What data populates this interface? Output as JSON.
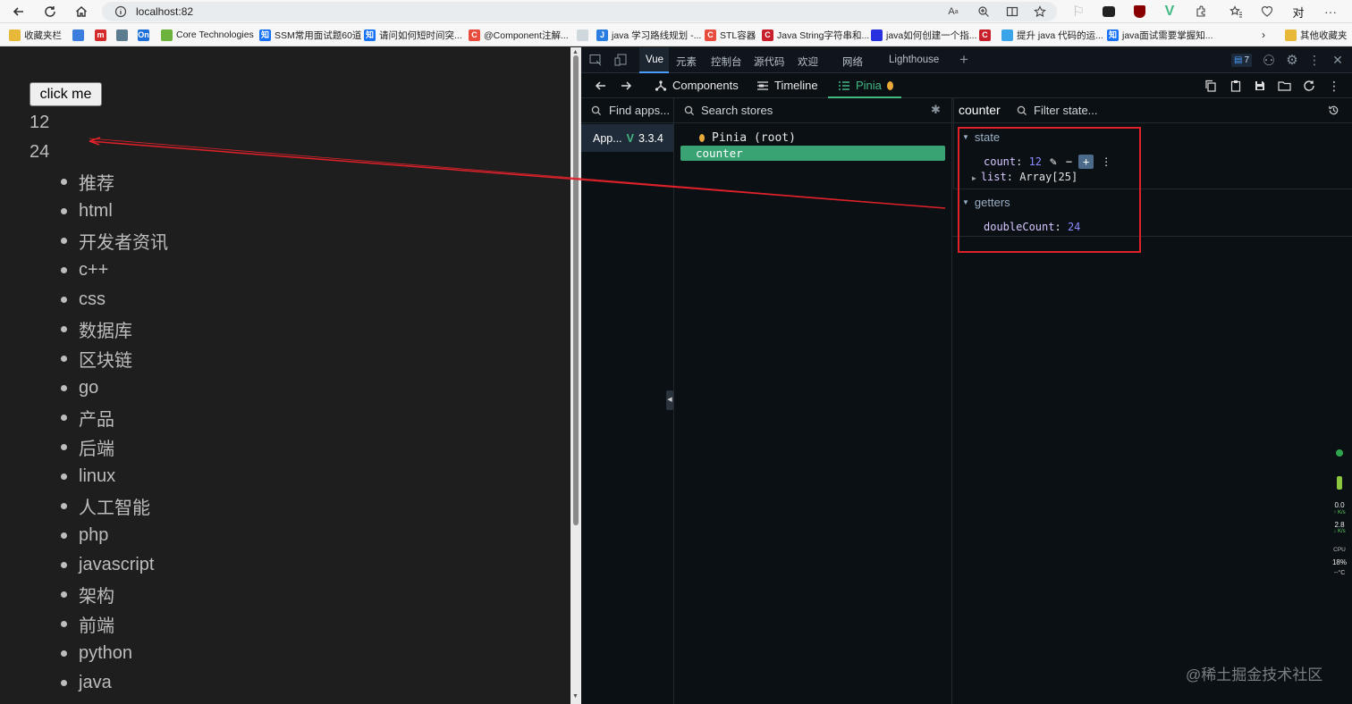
{
  "browser": {
    "url": "localhost:82",
    "bookmarks": [
      {
        "label": "收藏夹栏",
        "color": "#e8b938",
        "glyph": ""
      },
      {
        "label": "",
        "color": "#3b7ddd",
        "glyph": ""
      },
      {
        "label": "",
        "color": "#d42a2a",
        "glyph": "m"
      },
      {
        "label": "",
        "color": "#5b7d8f",
        "glyph": ""
      },
      {
        "label": "",
        "color": "#1e6fd9",
        "glyph": "On"
      },
      {
        "label": "Core Technologies",
        "color": "#6cb33e",
        "glyph": ""
      },
      {
        "label": "SSM常用面试题60道",
        "color": "#1772f6",
        "glyph": "知"
      },
      {
        "label": "请问如何短时间突...",
        "color": "#1772f6",
        "glyph": "知"
      },
      {
        "label": "@Component注解...",
        "color": "#e84c3d",
        "glyph": "C"
      },
      {
        "label": "",
        "color": "#cfd8dc",
        "glyph": ""
      },
      {
        "label": "java 学习路线规划 -...",
        "color": "#2a7de1",
        "glyph": "J"
      },
      {
        "label": "STL容器",
        "color": "#e84c3d",
        "glyph": "C"
      },
      {
        "label": "Java String字符串和...",
        "color": "#c8202a",
        "glyph": "C"
      },
      {
        "label": "java如何创建一个指...",
        "color": "#2932e1",
        "glyph": ""
      },
      {
        "label": "",
        "color": "#c8202a",
        "glyph": "C"
      },
      {
        "label": "提升 java 代码的运...",
        "color": "#3ba4e8",
        "glyph": ""
      },
      {
        "label": "java面试需要掌握知...",
        "color": "#1772f6",
        "glyph": "知"
      },
      {
        "label": "其他收藏夹",
        "color": "#e8b938",
        "glyph": ""
      }
    ]
  },
  "page": {
    "button_label": "click me",
    "count": "12",
    "double": "24",
    "list": [
      "推荐",
      "html",
      "开发者资讯",
      "c++",
      "css",
      "数据库",
      "区块链",
      "go",
      "产品",
      "后端",
      "linux",
      "人工智能",
      "php",
      "javascript",
      "架构",
      "前端",
      "python",
      "java"
    ]
  },
  "devtools": {
    "tabs": [
      "Vue",
      "元素",
      "控制台",
      "源代码",
      "欢迎",
      "网络",
      "Lighthouse"
    ],
    "issues_count": "7",
    "vue_tabs": {
      "components": "Components",
      "timeline": "Timeline",
      "pinia": "Pinia"
    },
    "find_apps_placeholder": "Find apps...",
    "app_name": "App...",
    "app_version": "3.3.4",
    "search_stores_placeholder": "Search stores",
    "stores": [
      "Pinia (root)",
      "counter"
    ],
    "selected_store": "counter",
    "filter_placeholder": "Filter state...",
    "state_label": "state",
    "count_key": "count",
    "count_value": "12",
    "list_key": "list",
    "list_value": "Array[25]",
    "getters_label": "getters",
    "getter_key": "doubleCount",
    "getter_value": "24"
  },
  "perf": {
    "up": "0.0",
    "down": "2.8",
    "unit": "K/s",
    "cpu_label": "CPU",
    "cpu": "18%",
    "temp": "--°C"
  },
  "watermark": "@稀土掘金技术社区",
  "colors": {
    "vue_green": "#42b883",
    "highlight": "#e0212a"
  }
}
